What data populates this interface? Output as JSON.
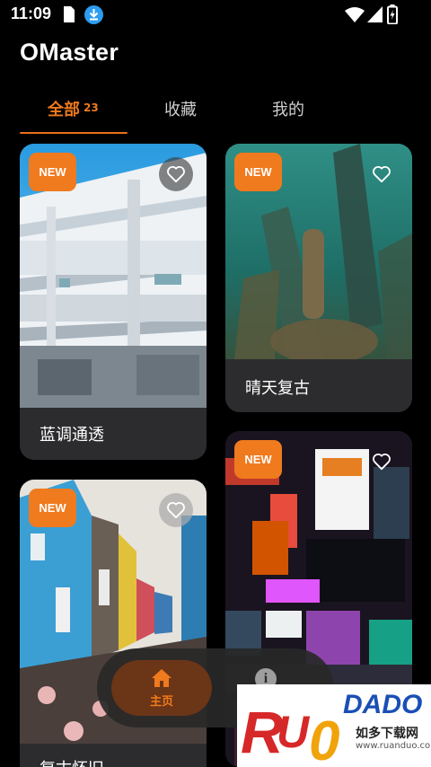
{
  "status_bar": {
    "time": "11:09",
    "icons": [
      "sim-card-icon",
      "download-icon",
      "wifi-icon",
      "signal-icon",
      "battery-charging-icon"
    ]
  },
  "app": {
    "title": "OMaster"
  },
  "tabs": [
    {
      "label": "全部",
      "count": "23",
      "active": true
    },
    {
      "label": "收藏",
      "active": false
    },
    {
      "label": "我的",
      "active": false
    }
  ],
  "cards": [
    {
      "label": "蓝调通透",
      "badge": "NEW",
      "favorite": false,
      "image": "white modern building with balconies under blue sky"
    },
    {
      "label": "晴天复古",
      "badge": "NEW",
      "favorite": false,
      "image": "underwater green scene with wooden pillars"
    },
    {
      "label": "复古怀旧",
      "badge": "NEW",
      "favorite": false,
      "image": "colorful wooden houses street"
    },
    {
      "label": "",
      "badge": "NEW",
      "favorite": false,
      "image": "neon signs night street"
    }
  ],
  "bottom_nav": {
    "items": [
      {
        "label": "主页",
        "icon": "home-icon",
        "active": true
      },
      {
        "label": "",
        "icon": "info-icon",
        "active": false
      }
    ]
  },
  "watermark": {
    "brand": "RUANDADO",
    "slogan": "如多下载网",
    "url": "www.ruanduo.com"
  },
  "colors": {
    "accent": "#f07a1e",
    "card_bg": "#2c2c2e",
    "background": "#000000"
  }
}
